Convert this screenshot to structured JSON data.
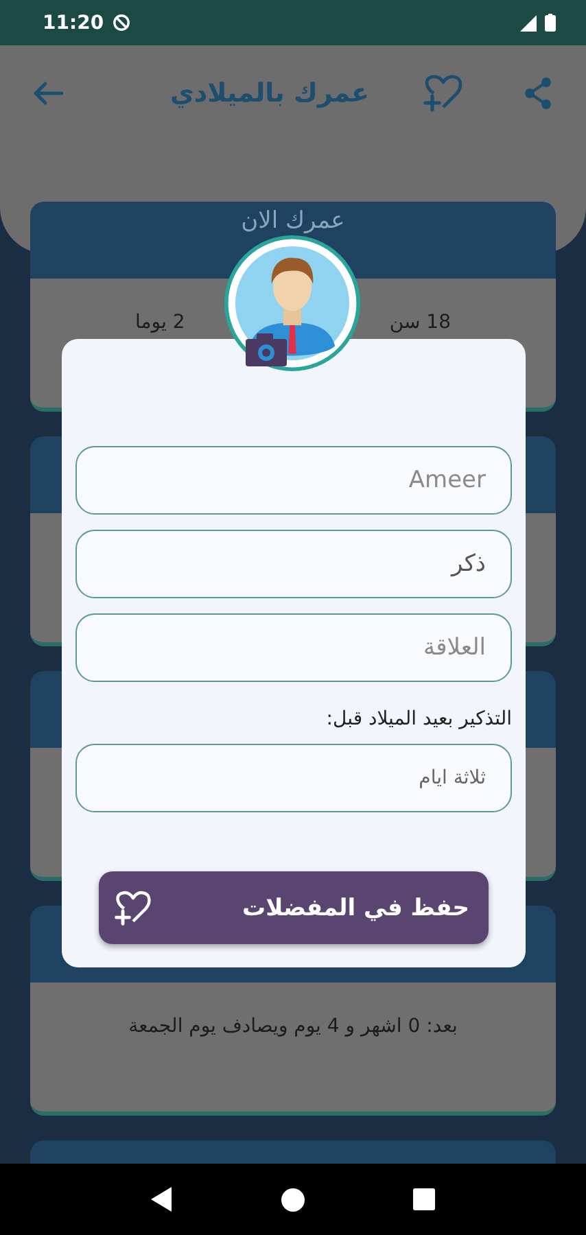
{
  "status_bar": {
    "time": "11:20"
  },
  "app_bar": {
    "title": "عمرك بالميلادي"
  },
  "background_cards": [
    {
      "kind": "split",
      "header": "عمرك الان",
      "body": [
        "18 سن",
        "2 يوما"
      ]
    },
    {
      "kind": "blank"
    },
    {
      "kind": "blank"
    },
    {
      "kind": "text",
      "body": [
        "بعد: 0 اشهر و 4 يوم ويصادف يوم الجمعة"
      ]
    },
    {
      "kind": "stub"
    }
  ],
  "dialog": {
    "fields": [
      {
        "placeholder": "Ameer"
      },
      {
        "value": "ذكر"
      },
      {
        "placeholder": "العلاقة"
      }
    ],
    "reminder_label": "التذكير بعيد الميلاد قبل:",
    "reminder_field": {
      "value": "ثلاثة ايام"
    },
    "save_button": "حفظ في المفضلات"
  }
}
